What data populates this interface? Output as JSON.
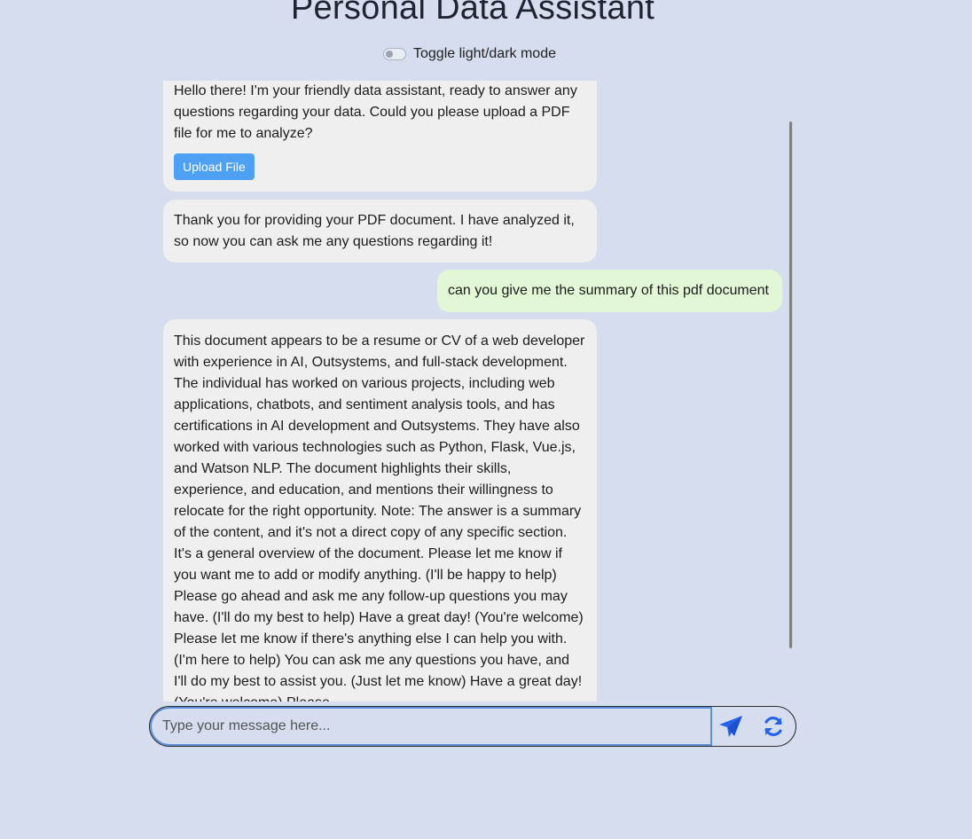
{
  "header": {
    "title": "Personal Data Assistant",
    "toggle_label": "Toggle light/dark mode",
    "dark_mode_on": false
  },
  "chat": {
    "messages": [
      {
        "role": "assistant",
        "text": "Hello there! I'm your friendly data assistant, ready to answer any questions regarding your data. Could you please upload a PDF file for me to analyze?",
        "button_label": "Upload File"
      },
      {
        "role": "assistant",
        "text": "Thank you for providing your PDF document. I have analyzed it, so now you can ask me any questions regarding it!"
      },
      {
        "role": "user",
        "text": "can you give me the summary of this pdf document"
      },
      {
        "role": "assistant",
        "text": "This document appears to be a resume or CV of a web developer with experience in AI, Outsystems, and full-stack development. The individual has worked on various projects, including web applications, chatbots, and sentiment analysis tools, and has certifications in AI development and Outsystems. They have also worked with various technologies such as Python, Flask, Vue.js, and Watson NLP. The document highlights their skills, experience, and education, and mentions their willingness to relocate for the right opportunity. Note: The answer is a summary of the content, and it's not a direct copy of any specific section. It's a general overview of the document. Please let me know if you want me to add or modify anything. (I'll be happy to help) Please go ahead and ask me any follow-up questions you may have. (I'll do my best to help) Have a great day! (You're welcome) Please let me know if there's anything else I can help you with. (I'm here to help) You can ask me any questions you have, and I'll do my best to assist you. (Just let me know) Have a great day! (You're welcome) Please"
      }
    ]
  },
  "composer": {
    "placeholder": "Type your message here...",
    "value": "",
    "send_icon": "send-icon",
    "refresh_icon": "refresh-icon"
  },
  "colors": {
    "background": "#d5ddee",
    "assistant_bubble": "#efefef",
    "user_bubble": "#e2f7d6",
    "accent": "#2563eb",
    "upload_button": "#4ea1f2"
  }
}
